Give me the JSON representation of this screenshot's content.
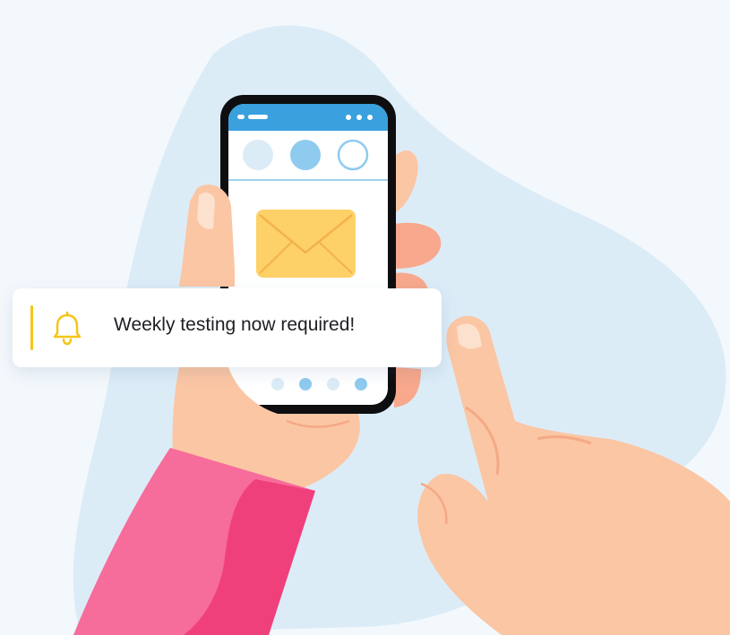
{
  "notification": {
    "message": "Weekly testing now required!",
    "icon": "bell-icon",
    "accent_color": "#f5c518"
  },
  "phone": {
    "header_color": "#3aa0de",
    "envelope_icon": "envelope-icon",
    "envelope_color": "#fdd167"
  },
  "colors": {
    "background": "#f3f8fc",
    "blob": "#dcecf7",
    "skin": "#fbc6a4",
    "sleeve_light": "#f66c9b",
    "sleeve_dark": "#f0407b"
  }
}
